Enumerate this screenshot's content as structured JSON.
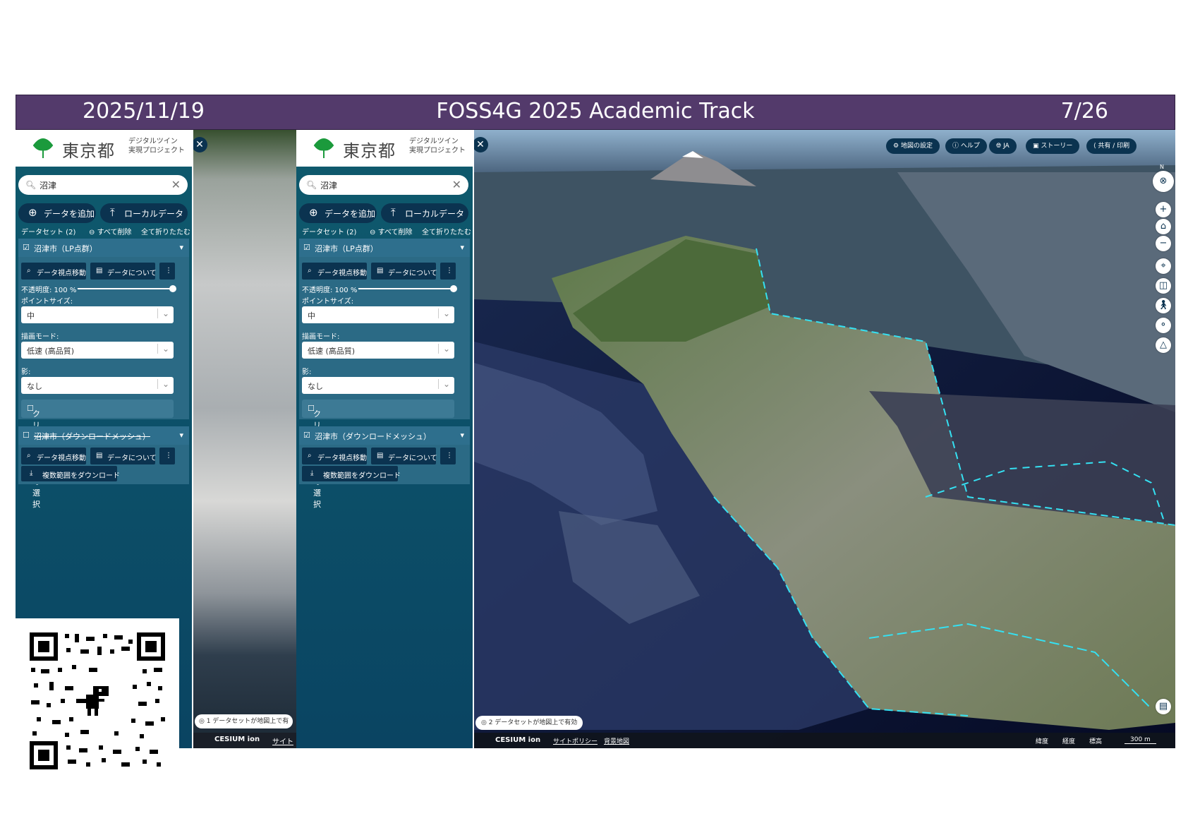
{
  "slide": {
    "date": "2025/11/19",
    "title": "FOSS4G 2025 Academic Track",
    "page": "7/26",
    "bar_color": "#533a6b"
  },
  "logo": {
    "name": "東京都",
    "sub_line1": "デジタルツイン",
    "sub_line2": "実現プロジェクト"
  },
  "panel": {
    "search_value": "沼津",
    "add_data": "データを追加",
    "local_data": "ローカルデータ",
    "dataset_count": "データセット (2)",
    "delete_all": "すべて削除",
    "collapse_all": "全て折りたたむ",
    "layer1_title": "沼津市（LP点群）",
    "layer2_title": "沼津市（ダウンロードメッシュ）",
    "move_view": "データ視点移動",
    "about_data": "データについて",
    "opacity_label": "不透明度: 100 %",
    "opacity_value": 1.0,
    "point_size_label": "ポイントサイズ:",
    "point_size_value": "中",
    "render_mode_label": "描画モード:",
    "render_mode_value": "低速 (高品質)",
    "shadow_label": "影:",
    "shadow_value": "なし",
    "clip_label": "クリップ方法の選択",
    "download_multi": "複数範囲をダウンロード"
  },
  "left_strip": {
    "status": "1 データセットが地図上で有",
    "footer_brand": "CESIUM ion",
    "footer_link": "サイトポ"
  },
  "map": {
    "toolbar": [
      "地図の設定",
      "ヘルプ",
      "JA",
      "ストーリー",
      "共有 / 印刷"
    ],
    "status": "2 データセットが地図上で有効",
    "footer_brand": "CESIUM ion",
    "footer_policy": "サイトポリシー",
    "footer_bg": "背景地図",
    "footer_lat": "緯度",
    "footer_lon": "経度",
    "footer_alt": "標高",
    "scale": "300 m",
    "compass_n": "N"
  },
  "icons": {
    "search": "search-icon",
    "close": "close-icon",
    "add": "plus-circle-icon",
    "upload": "upload-icon",
    "chevron": "chevron-down-icon",
    "kebab": "more-vertical-icon"
  }
}
